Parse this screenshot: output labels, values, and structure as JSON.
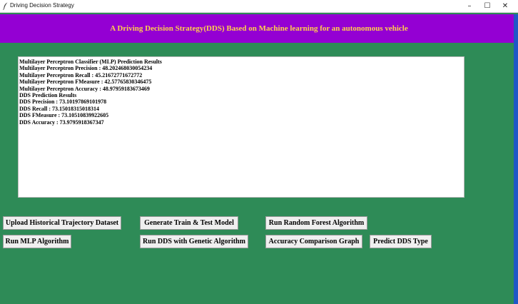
{
  "window": {
    "title": "Driving Decision Strategy",
    "controls": {
      "minimize": "–",
      "maximize": "☐",
      "close": "✕"
    }
  },
  "colors": {
    "background": "#2e8b57",
    "header_band": "#9400d3",
    "header_text": "#ffd24a",
    "output_bg": "#ffffff"
  },
  "header": {
    "title": "A Driving Decision Strategy(DDS) Based on Machine learning for an autonomous vehicle"
  },
  "output": {
    "lines": [
      "Multilayer Perceptron Classifier (MLP) Prediction Results",
      "Multilayer Perceptron Precision : 48.202468030054234",
      "Multilayer Perceptron Recall : 45.21672771672772",
      "Multilayer Perceptron FMeasure : 42.57765830346475",
      "Multilayer Perceptron Accuracy : 48.97959183673469",
      "DDS Prediction Results",
      "DDS Precision : 73.10197869101978",
      "DDS Recall : 73.15018315018314",
      "DDS FMeasure : 73.10510839922605",
      "DDS Accuracy : 73.9795918367347"
    ]
  },
  "buttons": {
    "upload_dataset": "Upload Historical Trajectory Dataset",
    "generate_model": "Generate Train & Test Model",
    "run_random_forest": "Run Random Forest Algorithm",
    "run_mlp": "Run MLP Algorithm",
    "run_dds_ga": "Run DDS with Genetic Algorithm",
    "accuracy_graph": "Accuracy Comparison Graph",
    "predict_dds": "Predict DDS Type"
  },
  "icons": {
    "app": "feather-icon"
  }
}
